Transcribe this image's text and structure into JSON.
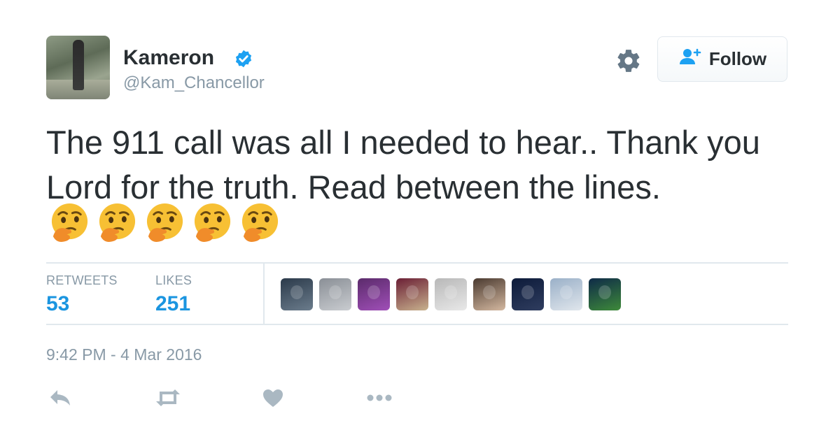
{
  "tweet": {
    "author": {
      "name": "Kameron",
      "handle": "@Kam_Chancellor",
      "verified": true
    },
    "follow_button_label": "Follow",
    "text": "The 911 call was all I needed to hear.. Thank you Lord for the truth. Read between the lines.",
    "emojis": [
      "🤔",
      "🤔",
      "🤔",
      "🤔",
      "🤔"
    ],
    "stats": {
      "retweets_label": "RETWEETS",
      "retweets_count": "53",
      "likes_label": "LIKES",
      "likes_count": "251"
    },
    "liker_avatars": [
      {
        "colors": [
          "#2b3a4a",
          "#6b7c8c"
        ]
      },
      {
        "colors": [
          "#8a8f96",
          "#c9ccd0"
        ]
      },
      {
        "colors": [
          "#5b2b6b",
          "#a04fb8"
        ]
      },
      {
        "colors": [
          "#6b1f35",
          "#c8b28e"
        ]
      },
      {
        "colors": [
          "#b8b8b8",
          "#e8e8e8"
        ]
      },
      {
        "colors": [
          "#4a3a30",
          "#d4b8a0"
        ]
      },
      {
        "colors": [
          "#0d1b3a",
          "#2f3d5f"
        ]
      },
      {
        "colors": [
          "#9ab0c8",
          "#e0e6ec"
        ]
      },
      {
        "colors": [
          "#0e2a48",
          "#3e8a3a"
        ]
      }
    ],
    "timestamp": "9:42 PM - 4 Mar 2016",
    "actions": [
      "reply-icon",
      "retweet-icon",
      "like-icon",
      "more-icon"
    ]
  },
  "colors": {
    "text": "#292f33",
    "muted": "#8899a6",
    "accent": "#1b95e0",
    "divider": "#e1e8ed",
    "verified": "#1da1f2"
  }
}
